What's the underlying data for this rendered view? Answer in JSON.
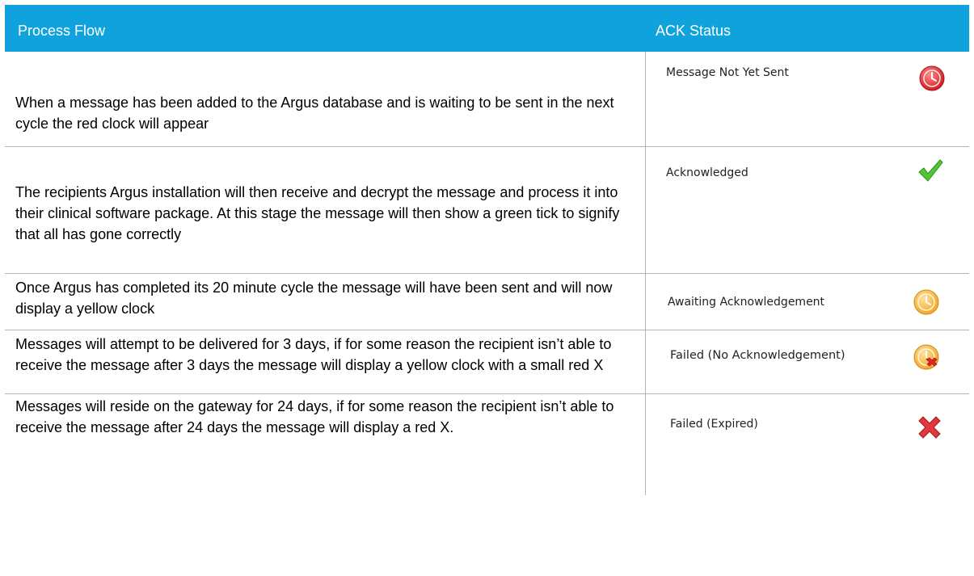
{
  "header": {
    "col1": "Process Flow",
    "col2": "ACK Status"
  },
  "rows": [
    {
      "text": "When a message has been added to the Argus database and is waiting to be sent in the next cycle the red clock will appear",
      "status": "Message Not Yet Sent",
      "icon": "red-clock-icon"
    },
    {
      "text": "The recipients Argus installation will then receive and decrypt the message and process it into their clinical software package. At this stage the message will then show a green tick to signify that all has gone correctly",
      "status": "Acknowledged",
      "icon": "green-tick-icon"
    },
    {
      "text": "Once Argus has completed its 20 minute cycle the message will have been sent and will now display a yellow clock",
      "status": "Awaiting Acknowledgement",
      "icon": "yellow-clock-icon"
    },
    {
      "text": "Messages will attempt to be delivered for 3 days, if for some reason the recipient isn’t able to receive the message after 3 days the message will display a yellow clock with a small red X",
      "status": "Failed (No Acknowledgement)",
      "icon": "yellow-clock-red-x-icon"
    },
    {
      "text": "Messages will reside on the gateway for 24 days, if for some reason the recipient isn’t able to receive the message after 24 days the message will display a red X.",
      "status": "Failed (Expired)",
      "icon": "red-x-icon"
    }
  ],
  "colors": {
    "header_bg": "#0fa2dd",
    "red": "#e0262b",
    "green": "#3cb521",
    "yellow": "#f6b73c"
  }
}
